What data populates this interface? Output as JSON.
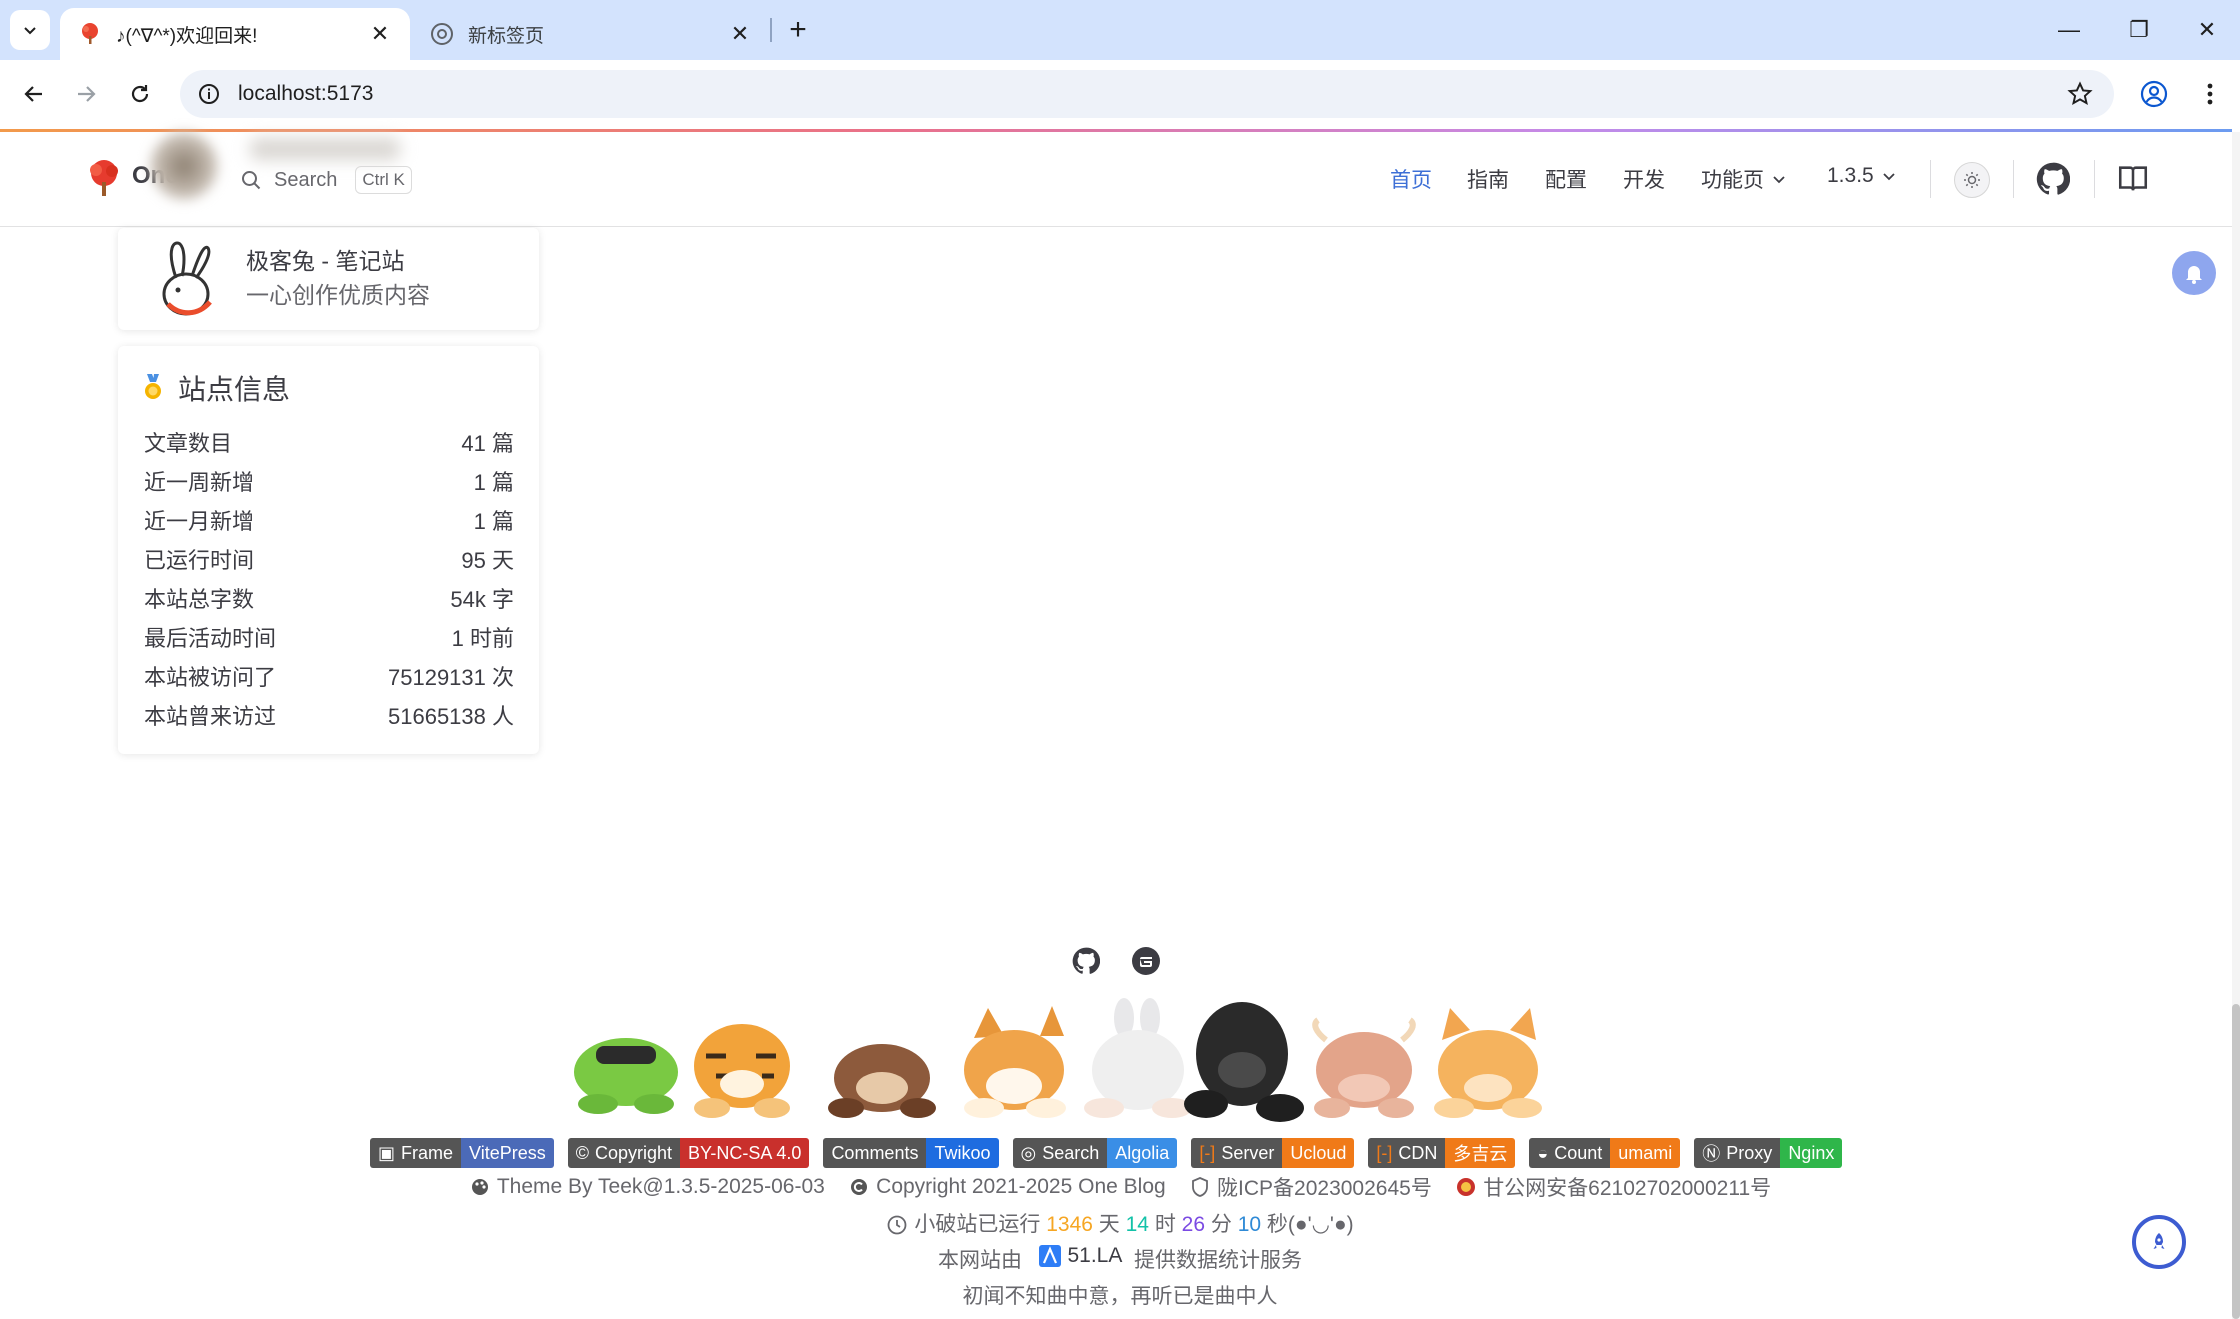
{
  "browser": {
    "tabs": [
      {
        "title": "♪(^∇^*)欢迎回来!",
        "active": true
      },
      {
        "title": "新标签页",
        "active": false
      }
    ],
    "url": "localhost:5173",
    "window_controls": {
      "minimize": "—",
      "restore": "❐",
      "close": "✕"
    }
  },
  "site": {
    "title": "One",
    "search": {
      "label": "Search",
      "shortcut": "Ctrl K"
    },
    "nav": [
      {
        "label": "首页",
        "active": true
      },
      {
        "label": "指南"
      },
      {
        "label": "配置"
      },
      {
        "label": "开发"
      },
      {
        "label": "功能页",
        "dropdown": true
      },
      {
        "label": "1.3.5",
        "dropdown": true
      }
    ]
  },
  "author": {
    "name": "极客兔 - 笔记站",
    "motto": "一心创作优质内容"
  },
  "site_info": {
    "title": "站点信息",
    "rows": [
      {
        "label": "文章数目",
        "value": "41 篇"
      },
      {
        "label": "近一周新增",
        "value": "1 篇"
      },
      {
        "label": "近一月新增",
        "value": "1 篇"
      },
      {
        "label": "已运行时间",
        "value": "95 天"
      },
      {
        "label": "本站总字数",
        "value": "54k 字"
      },
      {
        "label": "最后活动时间",
        "value": "1 时前"
      },
      {
        "label": "本站被访问了",
        "value": "75129131 次"
      },
      {
        "label": "本站曾来访过",
        "value": "51665138 人"
      }
    ]
  },
  "footer": {
    "badges": [
      {
        "left": "Frame",
        "right": "VitePress",
        "color": "#4b6ab8"
      },
      {
        "left": "Copyright",
        "right": "BY-NC-SA 4.0",
        "color": "#c9302c"
      },
      {
        "left": "Comments",
        "right": "Twikoo",
        "color": "#1e6ce0"
      },
      {
        "left": "Search",
        "right": "Algolia",
        "color": "#3a8ee6"
      },
      {
        "left": "Server",
        "right": "Ucloud",
        "color": "#f07a18"
      },
      {
        "left": "CDN",
        "right": "多吉云",
        "color": "#f07a18"
      },
      {
        "left": "Count",
        "right": "umami",
        "color": "#f07a18"
      },
      {
        "left": "Proxy",
        "right": "Nginx",
        "color": "#2fb64a"
      }
    ],
    "theme": "Theme By Teek@1.3.5-2025-06-03",
    "copyright": "Copyright 2021-2025 One Blog",
    "icp": "陇ICP备2023002645号",
    "police": "甘公网安备62102702000211号",
    "runtime": {
      "prefix": "小破站已运行",
      "days": "1346",
      "days_unit": "天",
      "hours": "14",
      "hours_unit": "时",
      "minutes": "26",
      "minutes_unit": "分",
      "seconds": "10",
      "seconds_unit": "秒(●'◡'●)"
    },
    "stats": {
      "prefix": "本网站由",
      "provider": "51.LA",
      "suffix": "提供数据统计服务"
    },
    "poem": "初闻不知曲中意，再听已是曲中人"
  },
  "colors": {
    "accent": "#3d6fd6",
    "tabbar": "#d3e3fd",
    "rocket": "#3d5cd1"
  }
}
